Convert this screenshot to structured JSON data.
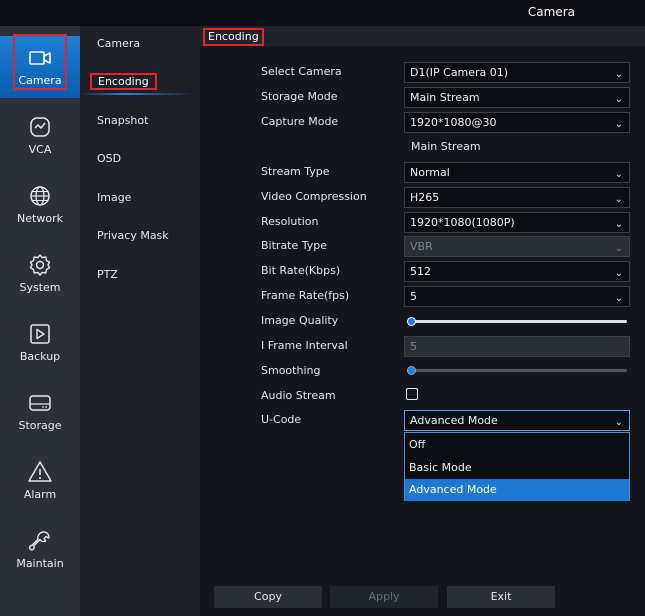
{
  "window": {
    "title": "Camera"
  },
  "nav": {
    "items": [
      {
        "label": "Camera",
        "icon": "camera-icon",
        "active": true
      },
      {
        "label": "VCA",
        "icon": "vca-icon"
      },
      {
        "label": "Network",
        "icon": "globe-icon"
      },
      {
        "label": "System",
        "icon": "gear-icon"
      },
      {
        "label": "Backup",
        "icon": "play-square-icon"
      },
      {
        "label": "Storage",
        "icon": "hard-drive-icon"
      },
      {
        "label": "Alarm",
        "icon": "warning-triangle-icon"
      },
      {
        "label": "Maintain",
        "icon": "wrench-icon"
      }
    ]
  },
  "subnav": {
    "items": [
      {
        "label": "Camera"
      },
      {
        "label": "Encoding",
        "active": true
      },
      {
        "label": "Snapshot"
      },
      {
        "label": "OSD"
      },
      {
        "label": "Image"
      },
      {
        "label": "Privacy Mask"
      },
      {
        "label": "PTZ"
      }
    ]
  },
  "page": {
    "header": "Encoding"
  },
  "form": {
    "select_camera": {
      "label": "Select Camera",
      "value": "D1(IP Camera 01)"
    },
    "storage_mode": {
      "label": "Storage Mode",
      "value": "Main Stream"
    },
    "capture_mode": {
      "label": "Capture Mode",
      "value": "1920*1080@30"
    },
    "section": "Main Stream",
    "stream_type": {
      "label": "Stream Type",
      "value": "Normal"
    },
    "video_compression": {
      "label": "Video Compression",
      "value": "H265"
    },
    "resolution": {
      "label": "Resolution",
      "value": "1920*1080(1080P)"
    },
    "bitrate_type": {
      "label": "Bitrate Type",
      "value": "VBR"
    },
    "bit_rate": {
      "label": "Bit Rate(Kbps)",
      "value": "512"
    },
    "frame_rate": {
      "label": "Frame Rate(fps)",
      "value": "5"
    },
    "image_quality": {
      "label": "Image Quality",
      "level": 0.02
    },
    "i_frame_interval": {
      "label": "I Frame Interval",
      "value": "5"
    },
    "smoothing": {
      "label": "Smoothing",
      "level": 0.02
    },
    "audio_stream": {
      "label": "Audio Stream",
      "checked": false
    },
    "u_code": {
      "label": "U-Code",
      "value": "Advanced Mode",
      "options": [
        "Off",
        "Basic Mode",
        "Advanced Mode"
      ]
    }
  },
  "buttons": {
    "copy": "Copy",
    "apply": "Apply",
    "exit": "Exit"
  },
  "colors": {
    "accent": "#1c78d3",
    "highlight_box": "#e2262b",
    "nav_bg": "#2b2f37"
  }
}
